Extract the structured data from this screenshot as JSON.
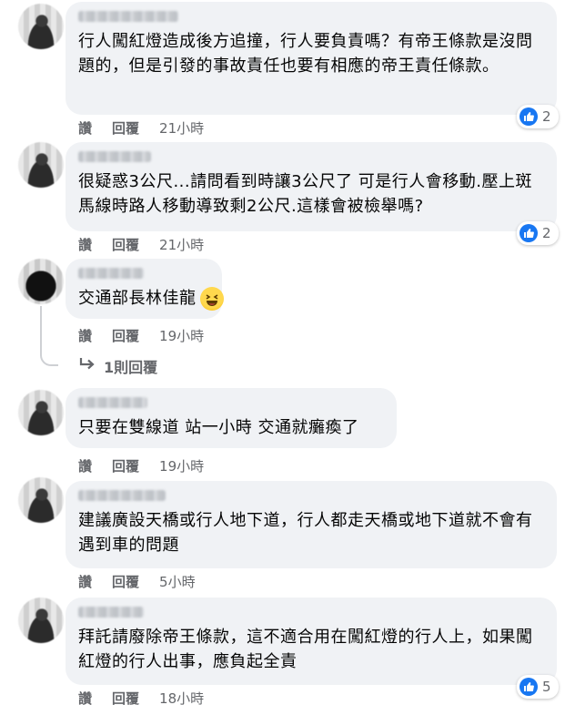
{
  "comments": [
    {
      "text": "行人闖紅燈造成後方追撞，行人要負責嗎？有帝王條款是沒問題的，但是引發的事故責任也要有相應的帝王責任條款。",
      "like": "讚",
      "reply": "回覆",
      "time": "21小時",
      "reactions": "2"
    },
    {
      "text": "很疑惑3公尺...請問看到時讓3公尺了 可是行人會移動.壓上斑馬線時路人移動導致剩2公尺.這樣會被檢舉嗎?",
      "like": "讚",
      "reply": "回覆",
      "time": "21小時",
      "reactions": "2"
    },
    {
      "text": "交通部長林佳龍",
      "emoji": "laughing-face-emoji",
      "like": "讚",
      "reply": "回覆",
      "time": "19小時",
      "replies_link": "1則回覆"
    },
    {
      "text": "只要在雙線道 站一小時 交通就癱瘓了",
      "like": "讚",
      "reply": "回覆",
      "time": "19小時"
    },
    {
      "text": "建議廣設天橋或行人地下道，行人都走天橋或地下道就不會有遇到車的問題",
      "like": "讚",
      "reply": "回覆",
      "time": "5小時"
    },
    {
      "text": "拜託請廢除帝王條款，這不適合用在闖紅燈的行人上，如果闖紅燈的行人出事，應負起全責",
      "like": "讚",
      "reply": "回覆",
      "time": "18小時",
      "reactions": "5"
    }
  ],
  "colors": {
    "bubble": "#f0f2f5",
    "like_blue": "#1877f2",
    "meta_gray": "#65676b"
  }
}
